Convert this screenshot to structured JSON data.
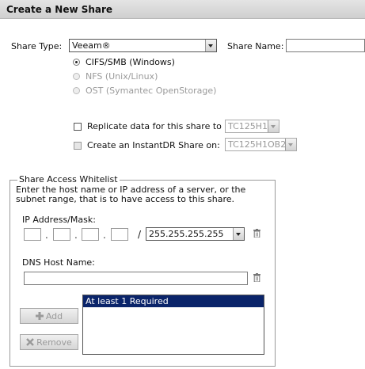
{
  "header": {
    "title": "Create a New Share"
  },
  "share_type": {
    "label": "Share Type:",
    "selected": "Veeam®"
  },
  "share_name": {
    "label": "Share Name:",
    "value": ""
  },
  "protocols": [
    {
      "label": "CIFS/SMB (Windows)",
      "selected": true,
      "enabled": true
    },
    {
      "label": "NFS (Unix/Linux)",
      "selected": false,
      "enabled": false
    },
    {
      "label": "OST (Symantec OpenStorage)",
      "selected": false,
      "enabled": false
    }
  ],
  "replicate": {
    "label": "Replicate data for this share to",
    "target": "TC125H1",
    "checked": false
  },
  "instantdr": {
    "label": "Create an InstantDR Share on:",
    "target": "TC125H1OB2",
    "checked": false
  },
  "whitelist": {
    "legend": "Share Access Whitelist",
    "description": "Enter the host name or IP address of a server, or the subnet range, that is to have access to this share.",
    "ip_label": "IP Address/Mask:",
    "ip_octets": [
      "",
      "",
      "",
      ""
    ],
    "mask_separator": "/",
    "mask": "255.255.255.255",
    "dns_label": "DNS Host Name:",
    "dns_value": "",
    "list_items": [
      "At least 1 Required"
    ],
    "add_label": "Add",
    "remove_label": "Remove"
  }
}
